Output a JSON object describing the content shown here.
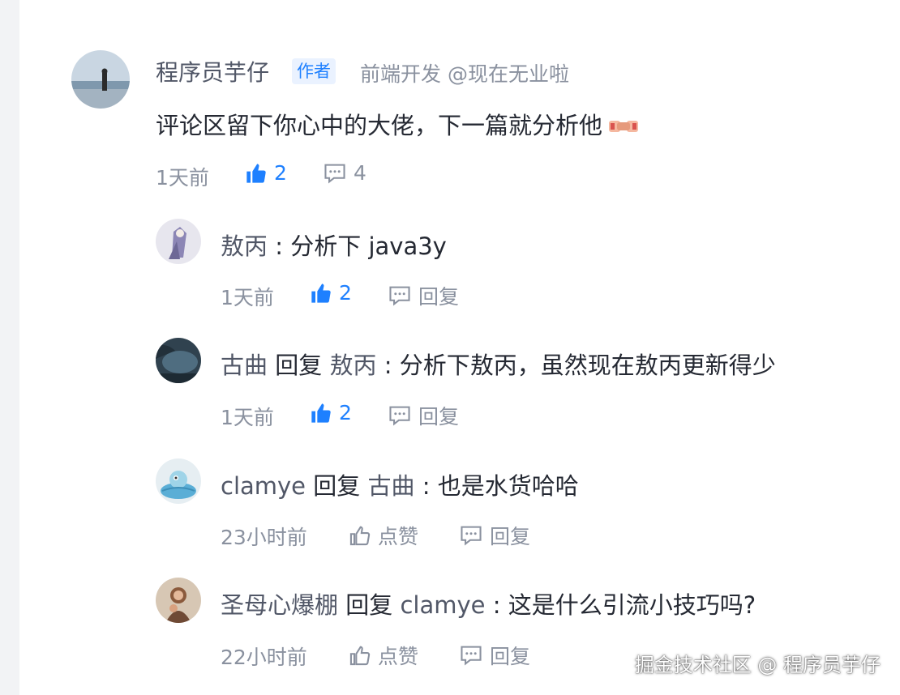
{
  "main_comment": {
    "author": "程序员芋仔",
    "badge": "作者",
    "subtitle": "前端开发 @现在无业啦",
    "text": "评论区留下你心中的大佬，下一篇就分析他",
    "emoji": "handshake-emoji",
    "time": "1天前",
    "likes": "2",
    "comments": "4",
    "liked": true
  },
  "replies": [
    {
      "author": "敖丙",
      "reply_word": "",
      "target": "",
      "separator": " : ",
      "text": "分析下 java3y",
      "time": "1天前",
      "like_label": "2",
      "reply_label": "回复",
      "liked": true
    },
    {
      "author": "古曲",
      "reply_word": "回复",
      "target": "敖丙",
      "separator": " : ",
      "text": "分析下敖丙，虽然现在敖丙更新得少",
      "time": "1天前",
      "like_label": "2",
      "reply_label": "回复",
      "liked": true
    },
    {
      "author": "clamye",
      "reply_word": "回复",
      "target": "古曲",
      "separator": " : ",
      "text": "也是水货哈哈",
      "time": "23小时前",
      "like_label": "点赞",
      "reply_label": "回复",
      "liked": false
    },
    {
      "author": "圣母心爆棚",
      "reply_word": "回复",
      "target": "clamye",
      "separator": " : ",
      "text": "这是什么引流小技巧吗?",
      "time": "22小时前",
      "like_label": "点赞",
      "reply_label": "回复",
      "liked": false
    }
  ],
  "watermark": "掘金技术社区 @ 程序员芋仔",
  "colors": {
    "accent": "#1e80ff",
    "muted": "#8a919f",
    "name": "#515767",
    "text": "#252933"
  }
}
